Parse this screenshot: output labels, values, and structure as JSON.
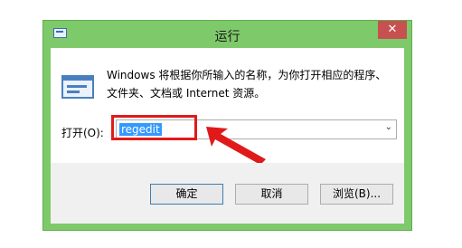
{
  "window": {
    "title": "运行",
    "close_glyph": "✕",
    "description_line1": "Windows 将根据你所输入的名称，为你打开相应的程序、",
    "description_line2": "文件夹、文档或 Internet 资源。",
    "open_label": "打开(O):",
    "open_value": "regedit",
    "dropdown_glyph": "⌄"
  },
  "buttons": {
    "ok": "确定",
    "cancel": "取消",
    "browse": "浏览(B)..."
  },
  "colors": {
    "frame": "#7ec96a",
    "close": "#c75050",
    "highlight": "#e01a1a",
    "selection": "#3399ff"
  },
  "icons": [
    "app-icon",
    "run-icon",
    "close-icon",
    "chevron-down-icon",
    "arrow-annotation"
  ]
}
